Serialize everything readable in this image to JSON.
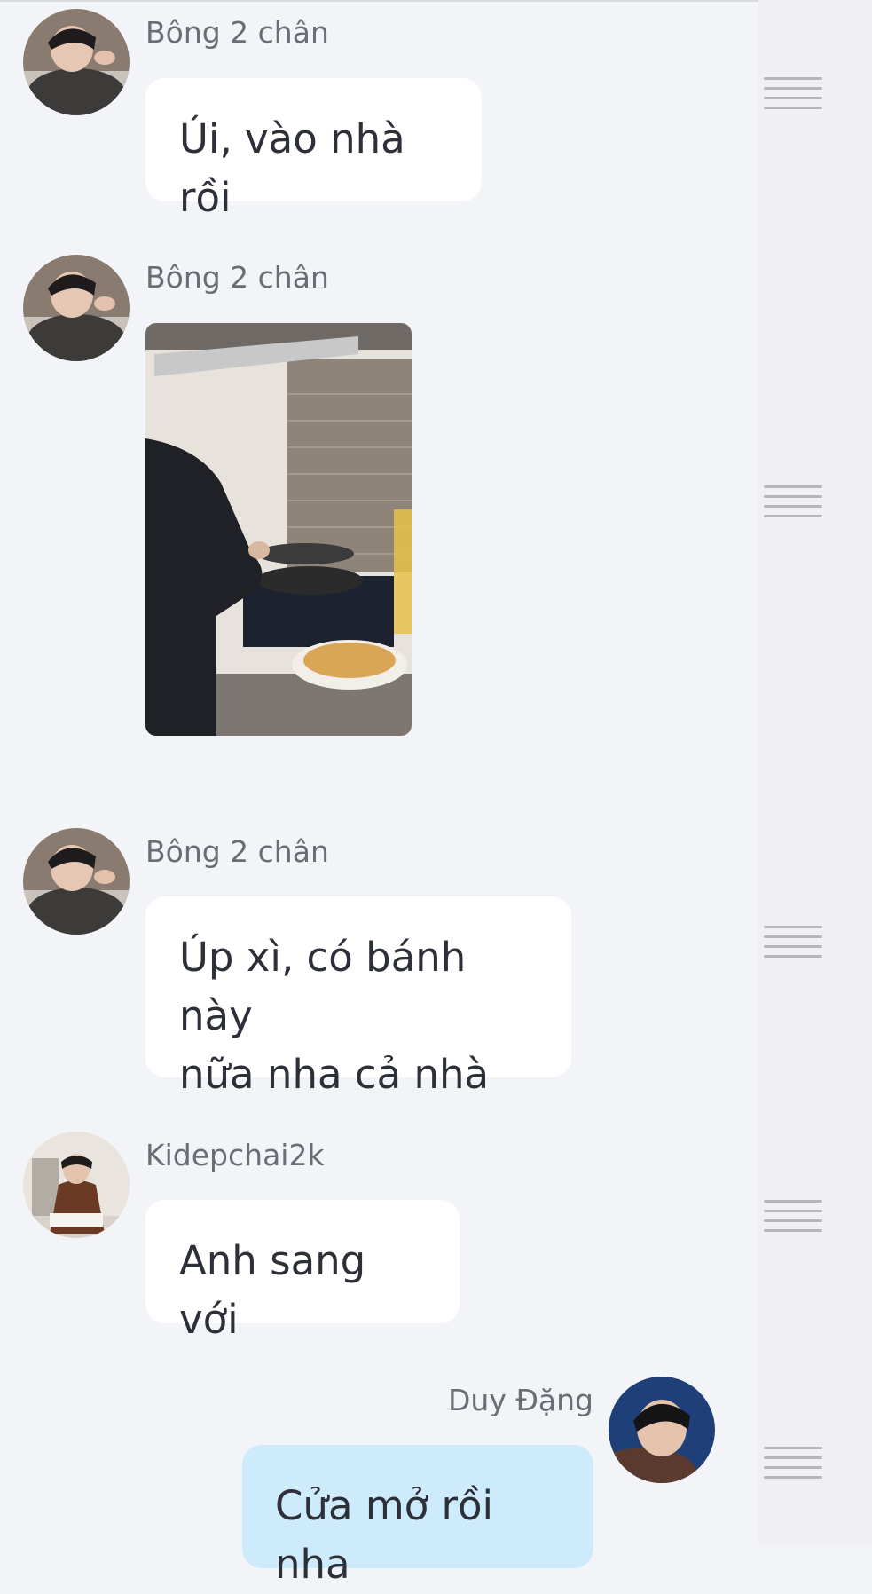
{
  "colors": {
    "background": "#f3f4f8",
    "incoming_bubble": "#ffffff",
    "outgoing_bubble": "#cdebfb",
    "sender_text": "#6a6d75",
    "message_text": "#2d3038"
  },
  "messages": [
    {
      "sender": "Bông 2 chân",
      "text": "Úi, vào nhà rồi",
      "direction": "incoming"
    },
    {
      "sender": "Bông 2 chân",
      "type": "image",
      "direction": "incoming"
    },
    {
      "sender": "Bông 2 chân",
      "lines": [
        "Úp xì, có bánh này",
        "nữa nha cả nhà"
      ],
      "direction": "incoming"
    },
    {
      "sender": "Kidepchai2k",
      "text": "Anh sang với",
      "direction": "incoming"
    },
    {
      "sender": "Duy Đặng",
      "text": "Cửa mở rồi nha",
      "direction": "outgoing"
    }
  ]
}
